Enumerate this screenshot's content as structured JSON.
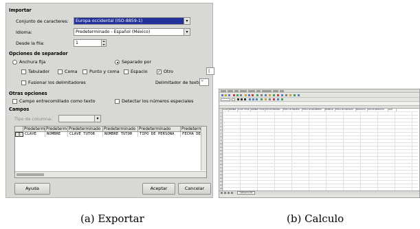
{
  "import_dialog": {
    "section_import": "Importar",
    "charset_label": "Conjunto de caracteres:",
    "charset_value": "Europa occidental (ISO-8859-1)",
    "language_label": "Idioma:",
    "language_value": "Predeterminado - Español (México)",
    "from_row_label": "Desde la fila:",
    "from_row_value": "1",
    "section_separator": "Opciones de separador",
    "fixed_width_label": "Anchura fija",
    "separated_by_label": "Separado por",
    "tab_label": "Tabulador",
    "comma_label": "Coma",
    "semicolon_label": "Punto y coma",
    "space_label": "Espacio",
    "other_label": "Otro",
    "other_value": "|",
    "merge_label": "Fusionar los delimitadores",
    "text_delimiter_label": "Delimitador de texto:",
    "text_delimiter_value": "\"",
    "section_other": "Otras opciones",
    "quoted_as_text_label": "Campo entrecomillado como texto",
    "detect_numbers_label": "Detectar los números especiales",
    "section_fields": "Campos",
    "column_type_label": "Tipo de columna:",
    "preview_headers": [
      "Predetermi",
      "Predeterm",
      "Predeterminado",
      "Predeterminado",
      "Predeterminado",
      "Predetermin"
    ],
    "preview_row_number": "1",
    "preview_cells": [
      "CLAVE",
      "NOMBRE",
      "CLAVE TUTOR",
      "NOMBRE TUTOR",
      "TIPO DE PERSONA",
      "FECHA DE N"
    ],
    "help_button": "Ayuda",
    "accept_button": "Aceptar",
    "cancel_button": "Cancelar"
  },
  "calc_window": {
    "column_headers": [
      "CLAVE",
      "NOMBRE",
      "CLAVE TUTOR",
      "NOMBRE TUTOR",
      "TIPO DE PERSONA",
      "FECHA DE INGRESO",
      "FECHA DE NACIMIENTO",
      "EJEMPLAR",
      "FECHA DE CONTRATO",
      "PRODUCTO",
      "TIPO DE PRODUCTO",
      "CIUD"
    ],
    "sheet_tab": "cepbasicos.txt"
  },
  "captions": {
    "left": "(a) Exportar",
    "right": "(b) Calculo"
  },
  "colors": {
    "dialog_bg": "#d8d8d5",
    "selection": "#23329b"
  }
}
